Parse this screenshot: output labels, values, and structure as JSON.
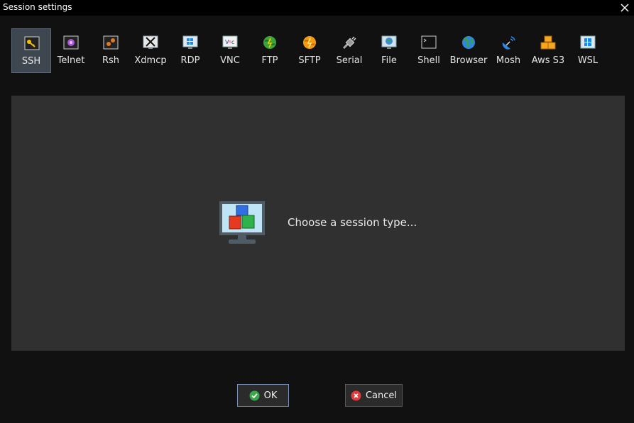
{
  "window": {
    "title": "Session settings",
    "close_glyph": "✕"
  },
  "tabs": [
    {
      "label": "SSH",
      "icon": "key-icon",
      "selected": true
    },
    {
      "label": "Telnet",
      "icon": "telnet-icon"
    },
    {
      "label": "Rsh",
      "icon": "rsh-icon"
    },
    {
      "label": "Xdmcp",
      "icon": "xdmcp-icon"
    },
    {
      "label": "RDP",
      "icon": "rdp-icon"
    },
    {
      "label": "VNC",
      "icon": "vnc-icon"
    },
    {
      "label": "FTP",
      "icon": "ftp-globe-icon"
    },
    {
      "label": "SFTP",
      "icon": "sftp-globe-icon"
    },
    {
      "label": "Serial",
      "icon": "serial-plug-icon"
    },
    {
      "label": "File",
      "icon": "file-monitor-icon"
    },
    {
      "label": "Shell",
      "icon": "terminal-icon"
    },
    {
      "label": "Browser",
      "icon": "globe-icon"
    },
    {
      "label": "Mosh",
      "icon": "satellite-dish-icon"
    },
    {
      "label": "Aws S3",
      "icon": "aws-s3-cubes-icon"
    },
    {
      "label": "WSL",
      "icon": "windows-logo-icon"
    }
  ],
  "main": {
    "prompt": "Choose a session type..."
  },
  "buttons": {
    "ok": "OK",
    "cancel": "Cancel"
  }
}
